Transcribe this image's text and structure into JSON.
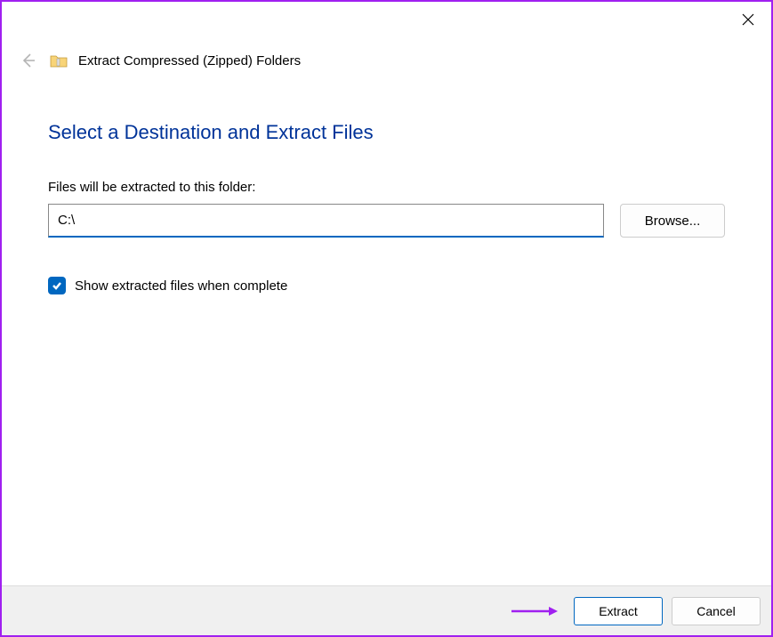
{
  "header": {
    "title": "Extract Compressed (Zipped) Folders"
  },
  "main": {
    "heading": "Select a Destination and Extract Files",
    "path_label": "Files will be extracted to this folder:",
    "path_value": "C:\\",
    "browse_label": "Browse...",
    "checkbox_label": "Show extracted files when complete",
    "checkbox_checked": true
  },
  "footer": {
    "extract_label": "Extract",
    "cancel_label": "Cancel"
  }
}
